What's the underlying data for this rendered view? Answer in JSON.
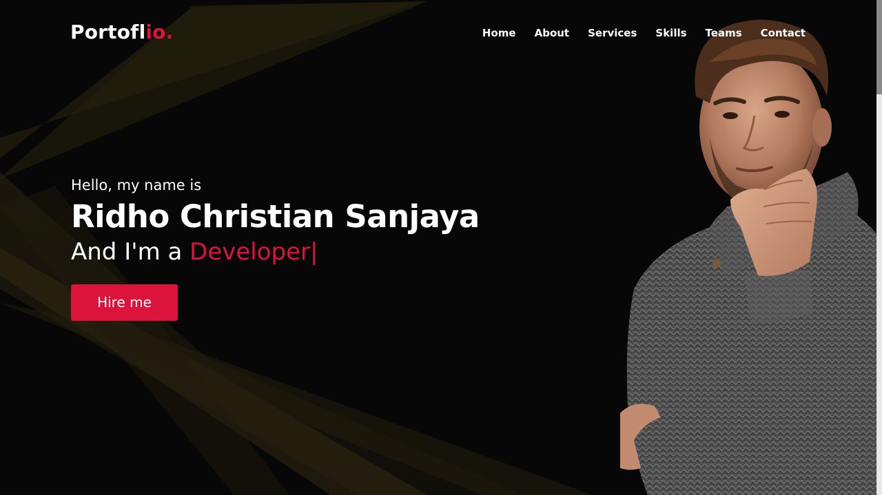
{
  "brand": {
    "logo_main": "Portofl",
    "logo_accent": "io.",
    "accent_color": "#dc143c"
  },
  "nav": {
    "items": [
      {
        "label": "Home"
      },
      {
        "label": "About"
      },
      {
        "label": "Services"
      },
      {
        "label": "Skills"
      },
      {
        "label": "Teams"
      },
      {
        "label": "Contact"
      }
    ]
  },
  "hero": {
    "greeting": "Hello, my name is",
    "name": "Ridho Christian Sanjaya",
    "role_prefix": "And I'm a",
    "role_typed": "Developer",
    "cursor": "|",
    "cta_label": "Hire me",
    "photo": "portrait of man in grey knit sweater, hand on chin"
  }
}
